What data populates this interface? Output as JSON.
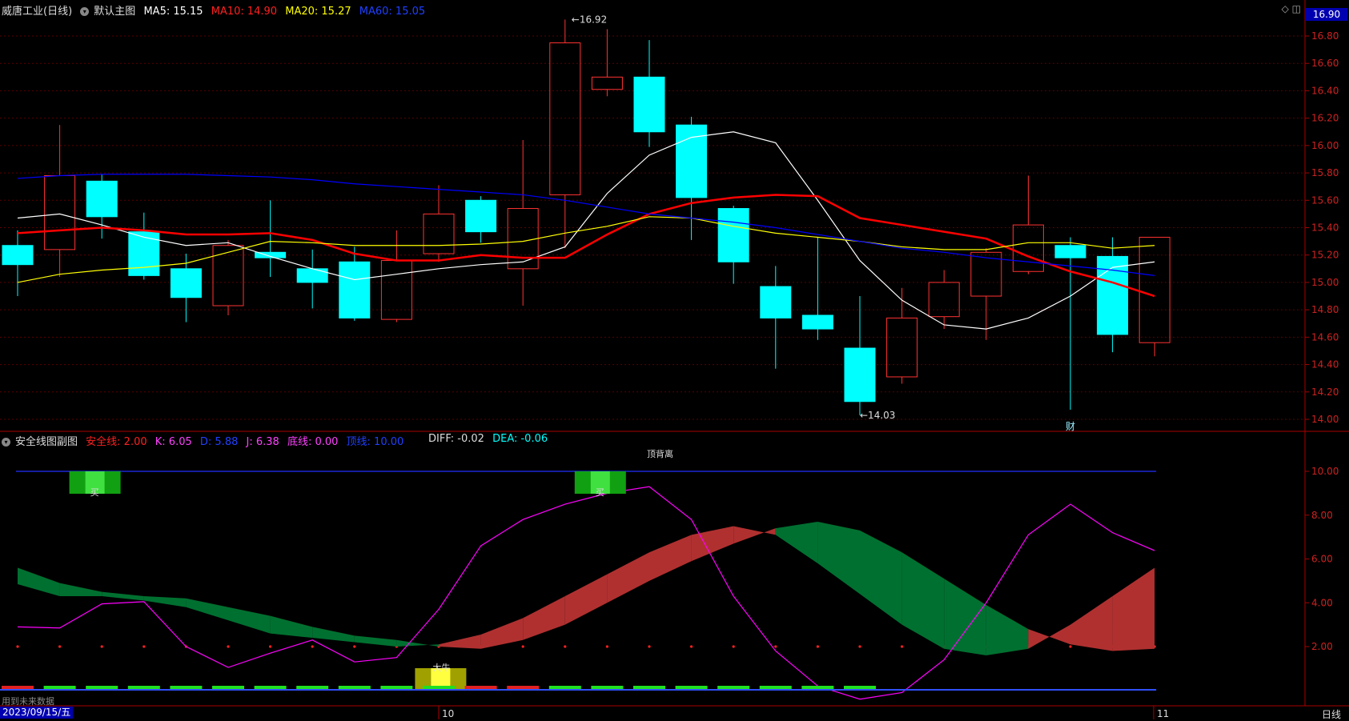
{
  "main_header": {
    "stock_label": "威唐工业(日线)",
    "template_label": "默认主图",
    "ma5": "MA5: 15.15",
    "ma10": "MA10: 14.90",
    "ma20": "MA20: 15.27",
    "ma60": "MA60: 15.05"
  },
  "sub_header": {
    "title": "安全线图副图",
    "safe": "安全线: 2.00",
    "k": "K: 6.05",
    "d": "D: 5.88",
    "j": "J: 6.38",
    "bottom": "底线: 0.00",
    "top": "顶线: 10.00",
    "diff": "DIFF: -0.02",
    "dea": "DEA: -0.06"
  },
  "price_box": "16.90",
  "date_box": "2023/09/15/五",
  "period_tag": "日线",
  "future_note": "用到未来数据",
  "month_labels": [
    "10",
    "11"
  ],
  "annotations": {
    "high": "16.92",
    "low": "14.03",
    "fin": "财",
    "buy1": "买",
    "buy2": "买",
    "bull": "大牛",
    "sub_cut": "顶背离"
  },
  "colors": {
    "up": "#ff3232",
    "down": "#00ffff",
    "ma5": "#ffffff",
    "ma10": "#ff0000",
    "ma20": "#ffff00",
    "ma60": "#0000ff",
    "k": "#ff00ff",
    "fill_up": "#b03030",
    "fill_down": "#007030"
  },
  "chart_data": [
    {
      "type": "candlestick",
      "title": "威唐工业(日线)",
      "ylim": [
        13.9,
        17.0
      ],
      "yticks": [
        "16.80",
        "16.60",
        "16.40",
        "16.20",
        "16.00",
        "15.80",
        "15.60",
        "15.40",
        "15.20",
        "15.00",
        "14.80",
        "14.60",
        "14.40",
        "14.20",
        "14.00"
      ],
      "candles": [
        {
          "o": 15.27,
          "h": 15.38,
          "l": 14.9,
          "c": 15.13
        },
        {
          "o": 15.24,
          "h": 16.15,
          "l": 15.04,
          "c": 15.78
        },
        {
          "o": 15.74,
          "h": 15.79,
          "l": 15.32,
          "c": 15.48
        },
        {
          "o": 15.37,
          "h": 15.51,
          "l": 15.02,
          "c": 15.05
        },
        {
          "o": 15.1,
          "h": 15.21,
          "l": 14.71,
          "c": 14.89
        },
        {
          "o": 14.83,
          "h": 15.31,
          "l": 14.76,
          "c": 15.27
        },
        {
          "o": 15.22,
          "h": 15.6,
          "l": 15.04,
          "c": 15.18
        },
        {
          "o": 15.1,
          "h": 15.24,
          "l": 14.81,
          "c": 15.0
        },
        {
          "o": 15.15,
          "h": 15.26,
          "l": 14.72,
          "c": 14.74
        },
        {
          "o": 14.73,
          "h": 15.38,
          "l": 14.71,
          "c": 15.16
        },
        {
          "o": 15.21,
          "h": 15.71,
          "l": 15.15,
          "c": 15.5
        },
        {
          "o": 15.6,
          "h": 15.63,
          "l": 15.29,
          "c": 15.37
        },
        {
          "o": 15.1,
          "h": 16.04,
          "l": 14.83,
          "c": 15.54
        },
        {
          "o": 15.64,
          "h": 16.92,
          "l": 15.25,
          "c": 16.75
        },
        {
          "o": 16.41,
          "h": 16.85,
          "l": 16.36,
          "c": 16.5
        },
        {
          "o": 16.5,
          "h": 16.77,
          "l": 15.99,
          "c": 16.1
        },
        {
          "o": 16.15,
          "h": 16.21,
          "l": 15.31,
          "c": 15.62
        },
        {
          "o": 15.54,
          "h": 15.56,
          "l": 14.99,
          "c": 15.15
        },
        {
          "o": 14.97,
          "h": 15.12,
          "l": 14.37,
          "c": 14.74
        },
        {
          "o": 14.76,
          "h": 15.33,
          "l": 14.58,
          "c": 14.66
        },
        {
          "o": 14.52,
          "h": 14.9,
          "l": 14.03,
          "c": 14.13
        },
        {
          "o": 14.31,
          "h": 14.96,
          "l": 14.26,
          "c": 14.74
        },
        {
          "o": 14.75,
          "h": 15.09,
          "l": 14.66,
          "c": 15.0
        },
        {
          "o": 14.9,
          "h": 15.25,
          "l": 14.58,
          "c": 15.22
        },
        {
          "o": 15.08,
          "h": 15.78,
          "l": 15.06,
          "c": 15.42
        },
        {
          "o": 15.27,
          "h": 15.33,
          "l": 14.07,
          "c": 15.18
        },
        {
          "o": 15.19,
          "h": 15.33,
          "l": 14.49,
          "c": 14.62
        },
        {
          "o": 14.56,
          "h": 15.33,
          "l": 14.46,
          "c": 15.33
        }
      ],
      "series": [
        {
          "name": "MA5",
          "values": [
            15.47,
            15.5,
            15.42,
            15.33,
            15.27,
            15.29,
            15.19,
            15.1,
            15.02,
            15.06,
            15.1,
            15.13,
            15.15,
            15.26,
            15.65,
            15.93,
            16.06,
            16.1,
            16.02,
            15.6,
            15.16,
            14.87,
            14.69,
            14.66,
            14.74,
            14.9,
            15.11,
            15.15
          ]
        },
        {
          "name": "MA10",
          "values": [
            15.36,
            15.38,
            15.4,
            15.38,
            15.35,
            15.35,
            15.36,
            15.31,
            15.21,
            15.16,
            15.16,
            15.2,
            15.18,
            15.18,
            15.35,
            15.5,
            15.58,
            15.62,
            15.64,
            15.63,
            15.47,
            15.42,
            15.37,
            15.32,
            15.19,
            15.08,
            15.0,
            14.9
          ]
        },
        {
          "name": "MA20",
          "values": [
            15.0,
            15.06,
            15.09,
            15.11,
            15.14,
            15.22,
            15.3,
            15.29,
            15.27,
            15.27,
            15.27,
            15.28,
            15.3,
            15.36,
            15.41,
            15.48,
            15.47,
            15.41,
            15.36,
            15.33,
            15.3,
            15.26,
            15.24,
            15.24,
            15.29,
            15.29,
            15.25,
            15.27
          ]
        },
        {
          "name": "MA60",
          "values": [
            15.76,
            15.78,
            15.79,
            15.79,
            15.79,
            15.78,
            15.77,
            15.75,
            15.72,
            15.7,
            15.68,
            15.66,
            15.64,
            15.6,
            15.55,
            15.5,
            15.47,
            15.44,
            15.4,
            15.35,
            15.3,
            15.25,
            15.22,
            15.18,
            15.15,
            15.12,
            15.09,
            15.05
          ]
        }
      ]
    },
    {
      "type": "line",
      "title": "安全线图副图",
      "ylim": [
        -0.5,
        11.5
      ],
      "yticks": [
        "10.00",
        "8.00",
        "6.00",
        "4.00",
        "2.00"
      ],
      "safe_line": 2.0,
      "top_line": 10.0,
      "series": [
        {
          "name": "K",
          "values": [
            4.85,
            4.3,
            4.3,
            4.1,
            3.8,
            3.2,
            2.6,
            2.4,
            2.2,
            2.0,
            2.1,
            2.55,
            3.3,
            4.3,
            5.3,
            6.3,
            7.1,
            7.5,
            7.1,
            5.8,
            4.4,
            3.0,
            1.9,
            1.6,
            1.9,
            3.0,
            4.3,
            5.6,
            6.0
          ]
        },
        {
          "name": "D",
          "values": [
            5.6,
            4.9,
            4.5,
            4.3,
            4.2,
            3.8,
            3.4,
            2.9,
            2.5,
            2.3,
            2.0,
            1.9,
            2.3,
            3.0,
            4.0,
            5.0,
            5.9,
            6.7,
            7.4,
            7.7,
            7.3,
            6.3,
            5.1,
            3.9,
            2.8,
            2.1,
            1.8,
            1.9,
            2.5,
            3.8,
            5.0,
            5.9,
            6.05
          ]
        },
        {
          "name": "J",
          "values": [
            2.9,
            2.85,
            3.95,
            4.05,
            2.0,
            1.05,
            1.7,
            2.3,
            1.3,
            1.5,
            3.7,
            6.6,
            7.8,
            8.5,
            9.0,
            9.3,
            7.8,
            4.3,
            1.8,
            0.2,
            -0.4,
            -0.1,
            1.4,
            4.0,
            7.1,
            8.5,
            7.2,
            6.38
          ]
        }
      ],
      "macd_bars": [
        0.1,
        0.1,
        0.1,
        0.1,
        0.1,
        0.1,
        0.1,
        0.1,
        0.1,
        0.1,
        0.1,
        0.1,
        0.1,
        0.1,
        0.1,
        0.1,
        0.1,
        0.1,
        0.1,
        0.1,
        0.1
      ]
    }
  ]
}
